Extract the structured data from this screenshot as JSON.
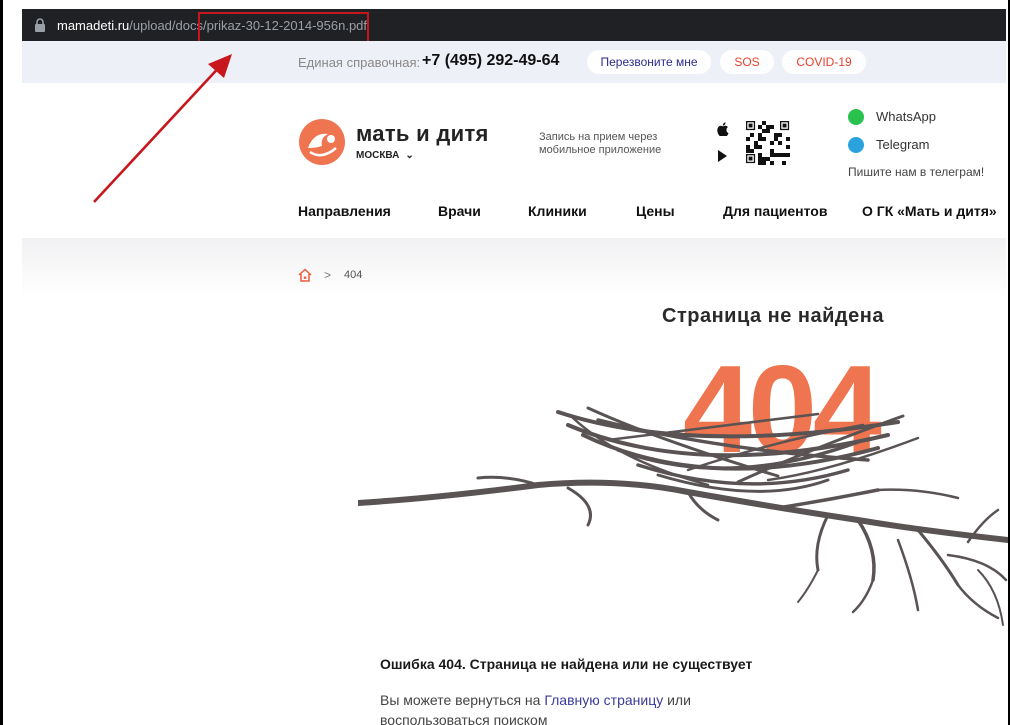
{
  "browser": {
    "url_host": "mamadeti.ru",
    "url_path": "/upload/docs/prikaz-30-12-2014-956n.pdf"
  },
  "topbar": {
    "ref_label": "Единая справочная:",
    "phone": "+7 (495) 292-49-64",
    "callback_label": "Перезвоните мне",
    "sos_label": "SOS",
    "covid_label": "COVID-19"
  },
  "header": {
    "brand": "мать и дитя",
    "city": "МОСКВА",
    "app_text": "Запись на прием через мобильное приложение",
    "whatsapp": "WhatsApp",
    "telegram": "Telegram",
    "telegram_note": "Пишите нам в телеграм!"
  },
  "nav": {
    "items": [
      "Направления",
      "Врачи",
      "Клиники",
      "Цены",
      "Для пациентов",
      "О ГК «Мать и дитя»"
    ]
  },
  "breadcrumb": {
    "current": "404"
  },
  "error": {
    "page_title": "Страница не найдена",
    "code": "404",
    "title": "Ошибка 404. Страница не найдена или не существует",
    "text_before": "Вы можете вернуться на ",
    "link": "Главную страницу",
    "text_after": " или воспользоваться поиском"
  },
  "colors": {
    "accent_orange": "#ef7550",
    "annotation_red": "#c8161d",
    "nest_gray": "#5a5354",
    "link_blue": "#3b3a9a"
  },
  "icons": {
    "lock": "lock-icon",
    "home": "home-icon",
    "apple": "apple-icon",
    "play": "google-play-icon",
    "whatsapp": "whatsapp-icon",
    "telegram": "telegram-icon"
  }
}
